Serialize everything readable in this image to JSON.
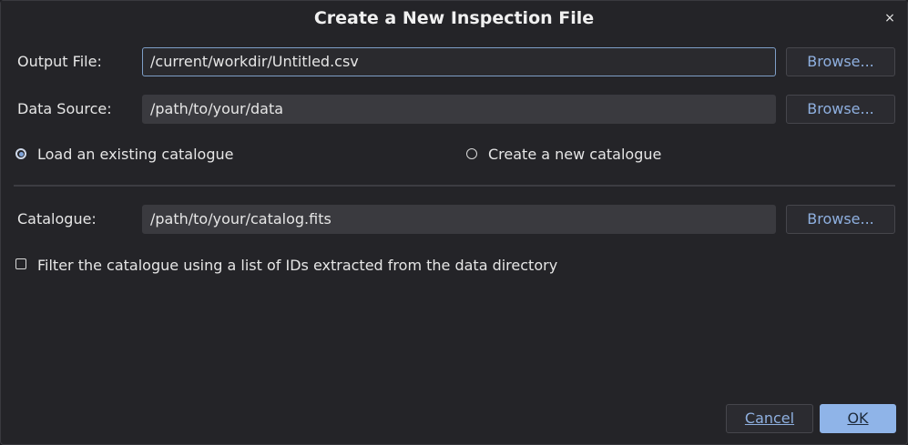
{
  "dialog": {
    "title": "Create a New Inspection File",
    "close_glyph": "×"
  },
  "output_file": {
    "label": "Output File:",
    "value": "/current/workdir/Untitled.csv",
    "browse_label": "Browse..."
  },
  "data_source": {
    "label": "Data Source:",
    "value": "/path/to/your/data",
    "browse_label": "Browse..."
  },
  "catalogue_mode": {
    "options": [
      {
        "label": "Load an existing catalogue",
        "checked": true
      },
      {
        "label": "Create a new catalogue",
        "checked": false
      }
    ]
  },
  "catalogue": {
    "label": "Catalogue:",
    "value": "/path/to/your/catalog.fits",
    "browse_label": "Browse..."
  },
  "filter": {
    "label": "Filter the catalogue using a list of IDs extracted from the data directory",
    "checked": false
  },
  "buttons": {
    "cancel_label": "Cancel",
    "ok_label": "OK"
  },
  "colors": {
    "background": "#242428",
    "field": "#3a3a3f",
    "accent": "#8fb4e8",
    "link_text": "#8fb0e0"
  }
}
